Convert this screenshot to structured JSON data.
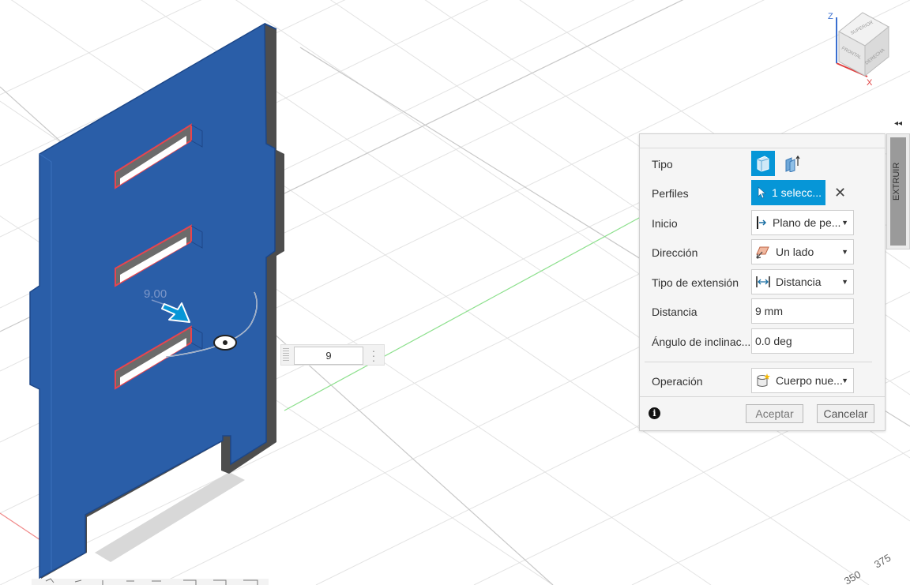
{
  "viewport": {
    "dimension_label": "9.00",
    "grid_labels": [
      "375",
      "350"
    ],
    "value_box": {
      "value": "9"
    }
  },
  "viewcube": {
    "faces": {
      "top": "SUPERIOR",
      "front": "FRONTAL",
      "right": "DERECHA"
    },
    "axes": {
      "z": "Z",
      "x": "X"
    }
  },
  "panel": {
    "rows": [
      {
        "label": "Tipo"
      },
      {
        "label": "Perfiles",
        "value": "1 selecc..."
      },
      {
        "label": "Inicio",
        "value": "Plano de pe..."
      },
      {
        "label": "Dirección",
        "value": "Un lado"
      },
      {
        "label": "Tipo de extensión",
        "value": "Distancia"
      },
      {
        "label": "Distancia",
        "value": "9 mm"
      },
      {
        "label": "Ángulo de inclinac...",
        "value": "0.0 deg"
      },
      {
        "label": "Operación",
        "value": "Cuerpo nue..."
      }
    ],
    "clear_glyph": "✕",
    "info_glyph": "i",
    "ok_label": "Aceptar",
    "cancel_label": "Cancelar"
  },
  "side_tab": {
    "label": "EXTRUIR",
    "collapse_glyph": "◂◂"
  },
  "colors": {
    "accent": "#0696d7",
    "part": "#2a5ea8",
    "part_dark": "#505050",
    "selection": "#e8454f"
  }
}
